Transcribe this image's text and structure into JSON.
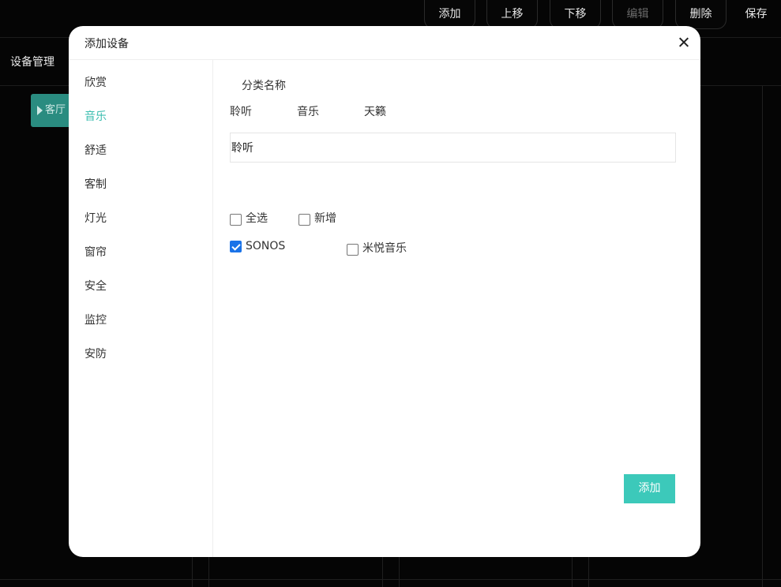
{
  "toolbar": {
    "add_label": "添加",
    "move_up_label": "上移",
    "move_down_label": "下移",
    "edit_label": "编辑",
    "delete_label": "删除",
    "save_label": "保存"
  },
  "background": {
    "section_title": "设备管理",
    "room_button_label": "客厅"
  },
  "modal": {
    "title": "添加设备",
    "categories": [
      {
        "label": "欣赏",
        "active": false
      },
      {
        "label": "音乐",
        "active": true
      },
      {
        "label": "舒适",
        "active": false
      },
      {
        "label": "客制",
        "active": false
      },
      {
        "label": "灯光",
        "active": false
      },
      {
        "label": "窗帘",
        "active": false
      },
      {
        "label": "安全",
        "active": false
      },
      {
        "label": "监控",
        "active": false
      },
      {
        "label": "安防",
        "active": false
      }
    ],
    "category_name_label": "分类名称",
    "name_tabs": [
      "聆听",
      "音乐",
      "天籁"
    ],
    "name_input_value": "聆听",
    "select_all_label": "全选",
    "new_label": "新增",
    "devices": [
      {
        "label": "SONOS",
        "checked": true
      },
      {
        "label": "米悦音乐",
        "checked": false
      }
    ],
    "add_button_label": "添加"
  },
  "colors": {
    "accent": "#3cc9ba",
    "active_text": "#3cbeb0",
    "checkbox_checked": "#1a73e8"
  }
}
